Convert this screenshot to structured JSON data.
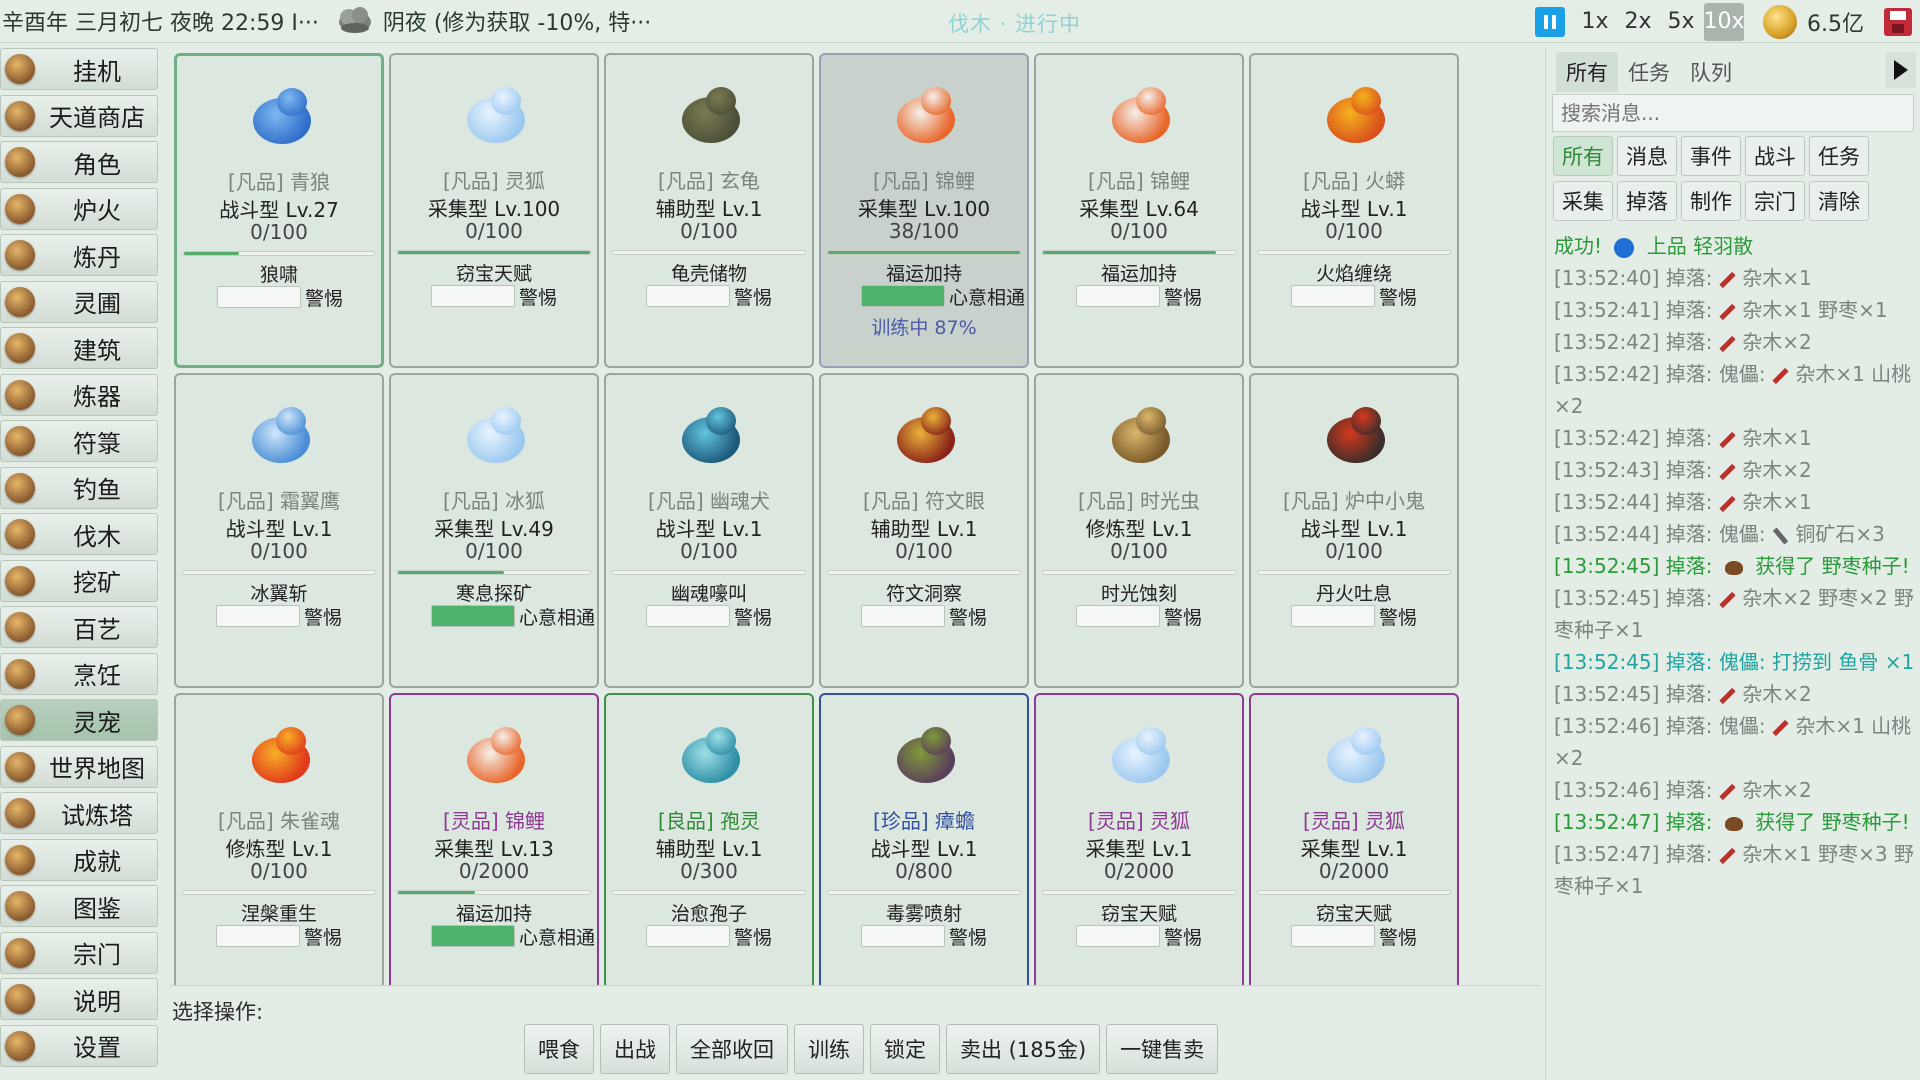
{
  "topbar": {
    "time": "辛酉年 三月初七 夜晚 22:59 I···",
    "weather_icon": "cloud-night-icon",
    "weather": "阴夜 (修为获取 -10%, 特···",
    "status": "伐木 · 进行中",
    "speeds": [
      "1x",
      "2x",
      "5x",
      "10x"
    ],
    "active_speed": "10x",
    "money": "6.5亿"
  },
  "menu": [
    {
      "label": "挂机",
      "icon": "scroll-icon"
    },
    {
      "label": "天道商店",
      "icon": "shop-icon"
    },
    {
      "label": "角色",
      "icon": "character-icon"
    },
    {
      "label": "炉火",
      "icon": "furnace-icon"
    },
    {
      "label": "炼丹",
      "icon": "cauldron-icon"
    },
    {
      "label": "灵圃",
      "icon": "garden-icon"
    },
    {
      "label": "建筑",
      "icon": "building-icon"
    },
    {
      "label": "炼器",
      "icon": "forge-icon"
    },
    {
      "label": "符箓",
      "icon": "talisman-icon"
    },
    {
      "label": "钓鱼",
      "icon": "fishing-icon"
    },
    {
      "label": "伐木",
      "icon": "axe-icon"
    },
    {
      "label": "挖矿",
      "icon": "pickaxe-icon"
    },
    {
      "label": "百艺",
      "icon": "tools-icon"
    },
    {
      "label": "烹饪",
      "icon": "cooking-icon"
    },
    {
      "label": "灵宠",
      "icon": "pet-icon"
    },
    {
      "label": "世界地图",
      "icon": "map-icon"
    },
    {
      "label": "试炼塔",
      "icon": "tower-icon"
    },
    {
      "label": "成就",
      "icon": "trophy-icon"
    },
    {
      "label": "图鉴",
      "icon": "book-icon"
    },
    {
      "label": "宗门",
      "icon": "sect-icon"
    },
    {
      "label": "说明",
      "icon": "help-icon"
    },
    {
      "label": "设置",
      "icon": "gear-icon"
    }
  ],
  "active_menu": "灵宠",
  "pets": [
    {
      "name": "[凡品] 青狼",
      "type": "战斗型  Lv.27",
      "exp": "0/100",
      "exp_pct": 0.29,
      "skill": "狼啸",
      "mood_label": "警惕",
      "mood_pct": 0,
      "quality": "common",
      "icon": "blue-wolf-icon",
      "c1": "#2f6fc9",
      "c2": "#7fb8f2",
      "state": "selected"
    },
    {
      "name": "[凡品] 灵狐",
      "type": "采集型  Lv.100",
      "exp": "0/100",
      "exp_pct": 1.0,
      "skill": "窃宝天赋",
      "mood_label": "警惕",
      "mood_pct": 0,
      "quality": "common",
      "icon": "spirit-fox-icon",
      "c1": "#9cc8ef",
      "c2": "#e8f4ff"
    },
    {
      "name": "[凡品] 玄龟",
      "type": "辅助型  Lv.1",
      "exp": "0/100",
      "exp_pct": 0,
      "skill": "龟壳储物",
      "mood_label": "警惕",
      "mood_pct": 0,
      "quality": "common",
      "icon": "turtle-icon",
      "c1": "#4d5038",
      "c2": "#7b7a52"
    },
    {
      "name": "[凡品] 锦鲤",
      "type": "采集型  Lv.100",
      "exp": "38/100",
      "exp_pct": 1.0,
      "skill": "福运加持",
      "mood_label": "心意相通",
      "mood_pct": 1.0,
      "quality": "common",
      "icon": "koi-icon",
      "c1": "#e8662a",
      "c2": "#f5f0ea",
      "state": "training",
      "train": "训练中 87%"
    },
    {
      "name": "[凡品] 锦鲤",
      "type": "采集型  Lv.64",
      "exp": "0/100",
      "exp_pct": 0.9,
      "skill": "福运加持",
      "mood_label": "警惕",
      "mood_pct": 0,
      "quality": "common",
      "icon": "koi-icon",
      "c1": "#e8662a",
      "c2": "#f5f0ea"
    },
    {
      "name": "[凡品] 火蟒",
      "type": "战斗型  Lv.1",
      "exp": "0/100",
      "exp_pct": 0,
      "skill": "火焰缠绕",
      "mood_label": "警惕",
      "mood_pct": 0,
      "quality": "common",
      "icon": "fire-python-icon",
      "c1": "#d9501c",
      "c2": "#f5b21e"
    },
    {
      "name": "[凡品] 霜翼鹰",
      "type": "战斗型  Lv.1",
      "exp": "0/100",
      "exp_pct": 0,
      "skill": "冰翼斩",
      "mood_label": "警惕",
      "mood_pct": 0,
      "quality": "common",
      "icon": "frost-eagle-icon",
      "c1": "#4a8ed6",
      "c2": "#cfe6fb"
    },
    {
      "name": "[凡品] 冰狐",
      "type": "采集型  Lv.49",
      "exp": "0/100",
      "exp_pct": 0.55,
      "skill": "寒息探矿",
      "mood_label": "心意相通",
      "mood_pct": 1.0,
      "quality": "common",
      "icon": "ice-fox-icon",
      "c1": "#9cc8ef",
      "c2": "#e8f4ff"
    },
    {
      "name": "[凡品] 幽魂犬",
      "type": "战斗型  Lv.1",
      "exp": "0/100",
      "exp_pct": 0,
      "skill": "幽魂嚎叫",
      "mood_label": "警惕",
      "mood_pct": 0,
      "quality": "common",
      "icon": "ghost-hound-icon",
      "c1": "#1d5a7c",
      "c2": "#62c4df"
    },
    {
      "name": "[凡品] 符文眼",
      "type": "辅助型  Lv.1",
      "exp": "0/100",
      "exp_pct": 0,
      "skill": "符文洞察",
      "mood_label": "警惕",
      "mood_pct": 0,
      "quality": "common",
      "icon": "rune-eye-icon",
      "c1": "#8a2318",
      "c2": "#e9b23a"
    },
    {
      "name": "[凡品] 时光虫",
      "type": "修炼型  Lv.1",
      "exp": "0/100",
      "exp_pct": 0,
      "skill": "时光蚀刻",
      "mood_label": "警惕",
      "mood_pct": 0,
      "quality": "common",
      "icon": "time-bug-icon",
      "c1": "#7a5a2a",
      "c2": "#d9b66b"
    },
    {
      "name": "[凡品] 炉中小鬼",
      "type": "战斗型  Lv.1",
      "exp": "0/100",
      "exp_pct": 0,
      "skill": "丹火吐息",
      "mood_label": "警惕",
      "mood_pct": 0,
      "quality": "common",
      "icon": "furnace-imp-icon",
      "c1": "#3a2e2a",
      "c2": "#d6381d"
    },
    {
      "name": "[凡品] 朱雀魂",
      "type": "修炼型  Lv.1",
      "exp": "0/100",
      "exp_pct": 0,
      "skill": "涅槃重生",
      "mood_label": "警惕",
      "mood_pct": 0,
      "quality": "common",
      "icon": "vermilion-bird-icon",
      "c1": "#e0391b",
      "c2": "#f7b028"
    },
    {
      "name": "[灵品] 锦鲤",
      "type": "采集型  Lv.13",
      "exp": "0/2000",
      "exp_pct": 0.4,
      "skill": "福运加持",
      "mood_label": "心意相通",
      "mood_pct": 1.0,
      "quality": "spirit",
      "icon": "koi-icon",
      "c1": "#e8662a",
      "c2": "#f5f0ea"
    },
    {
      "name": "[良品] 孢灵",
      "type": "辅助型  Lv.1",
      "exp": "0/300",
      "exp_pct": 0,
      "skill": "治愈孢子",
      "mood_label": "警惕",
      "mood_pct": 0,
      "quality": "good",
      "icon": "spore-spirit-icon",
      "c1": "#2f8fa6",
      "c2": "#9fe0e8"
    },
    {
      "name": "[珍品] 瘴蟾",
      "type": "战斗型  Lv.1",
      "exp": "0/800",
      "exp_pct": 0,
      "skill": "毒雾喷射",
      "mood_label": "警惕",
      "mood_pct": 0,
      "quality": "rare",
      "icon": "miasma-toad-icon",
      "c1": "#5a3f5a",
      "c2": "#7f9a3a"
    },
    {
      "name": "[灵品] 灵狐",
      "type": "采集型  Lv.1",
      "exp": "0/2000",
      "exp_pct": 0,
      "skill": "窃宝天赋",
      "mood_label": "警惕",
      "mood_pct": 0,
      "quality": "spirit",
      "icon": "spirit-fox-icon",
      "c1": "#9cc8ef",
      "c2": "#e8f4ff"
    },
    {
      "name": "[灵品] 灵狐",
      "type": "采集型  Lv.1",
      "exp": "0/2000",
      "exp_pct": 0,
      "skill": "窃宝天赋",
      "mood_label": "警惕",
      "mood_pct": 0,
      "quality": "spirit",
      "icon": "spirit-fox-icon",
      "c1": "#9cc8ef",
      "c2": "#e8f4ff"
    }
  ],
  "actions": {
    "prompt": "选择操作:",
    "buttons": [
      "喂食",
      "出战",
      "全部收回",
      "训练",
      "锁定",
      "卖出 (185金)",
      "一键售卖"
    ]
  },
  "right_panel": {
    "tabs": [
      "所有",
      "任务",
      "队列"
    ],
    "active_tab": "所有",
    "search_placeholder": "搜索消息...",
    "filters": [
      "所有",
      "消息",
      "事件",
      "战斗",
      "任务",
      "采集",
      "掉落",
      "制作",
      "宗门",
      "清除"
    ],
    "active_filter": "所有",
    "log": [
      {
        "parts": [
          {
            "t": "成功! "
          },
          {
            "i": "dot"
          },
          {
            "t": " 上品 轻羽散"
          }
        ],
        "color": "green"
      },
      {
        "parts": [
          {
            "t": "[13:52:40] 掉落: "
          },
          {
            "i": "axe"
          },
          {
            "t": " 杂木×1"
          }
        ],
        "color": "gray"
      },
      {
        "parts": [
          {
            "t": "[13:52:41] 掉落: "
          },
          {
            "i": "axe"
          },
          {
            "t": " 杂木×1 野枣×1"
          }
        ],
        "color": "gray"
      },
      {
        "parts": [
          {
            "t": "[13:52:42] 掉落: "
          },
          {
            "i": "axe"
          },
          {
            "t": " 杂木×2"
          }
        ],
        "color": "gray"
      },
      {
        "parts": [
          {
            "t": "[13:52:42] 掉落: 傀儡: "
          },
          {
            "i": "axe"
          },
          {
            "t": " 杂木×1 山桃×2"
          }
        ],
        "color": "gray"
      },
      {
        "parts": [
          {
            "t": "[13:52:42] 掉落: "
          },
          {
            "i": "axe"
          },
          {
            "t": " 杂木×1"
          }
        ],
        "color": "gray"
      },
      {
        "parts": [
          {
            "t": "[13:52:43] 掉落: "
          },
          {
            "i": "axe"
          },
          {
            "t": " 杂木×2"
          }
        ],
        "color": "gray"
      },
      {
        "parts": [
          {
            "t": "[13:52:44] 掉落: "
          },
          {
            "i": "axe"
          },
          {
            "t": " 杂木×1"
          }
        ],
        "color": "gray"
      },
      {
        "parts": [
          {
            "t": "[13:52:44] 掉落: 傀儡: "
          },
          {
            "i": "pick"
          },
          {
            "t": " 铜矿石×3"
          }
        ],
        "color": "gray"
      },
      {
        "parts": [
          {
            "t": "[13:52:45] 掉落: "
          },
          {
            "i": "seed"
          },
          {
            "t": " 获得了 野枣种子!"
          }
        ],
        "color": "green"
      },
      {
        "parts": [
          {
            "t": "[13:52:45] 掉落: "
          },
          {
            "i": "axe"
          },
          {
            "t": " 杂木×2 野枣×2 野枣种子×1"
          }
        ],
        "color": "gray"
      },
      {
        "parts": [
          {
            "t": "[13:52:45] 掉落: 傀儡: 打捞到 鱼骨 ×1"
          }
        ],
        "color": "cyan"
      },
      {
        "parts": [
          {
            "t": "[13:52:45] 掉落: "
          },
          {
            "i": "axe"
          },
          {
            "t": " 杂木×2"
          }
        ],
        "color": "gray"
      },
      {
        "parts": [
          {
            "t": "[13:52:46] 掉落: 傀儡: "
          },
          {
            "i": "axe"
          },
          {
            "t": " 杂木×1 山桃×2"
          }
        ],
        "color": "gray"
      },
      {
        "parts": [
          {
            "t": "[13:52:46] 掉落: "
          },
          {
            "i": "axe"
          },
          {
            "t": " 杂木×2"
          }
        ],
        "color": "gray"
      },
      {
        "parts": [
          {
            "t": "[13:52:47] 掉落: "
          },
          {
            "i": "seed"
          },
          {
            "t": " 获得了 野枣种子!"
          }
        ],
        "color": "green"
      },
      {
        "parts": [
          {
            "t": "[13:52:47] 掉落: "
          },
          {
            "i": "axe"
          },
          {
            "t": " 杂木×1 野枣×3 野枣种子×1"
          }
        ],
        "color": "gray"
      }
    ]
  }
}
